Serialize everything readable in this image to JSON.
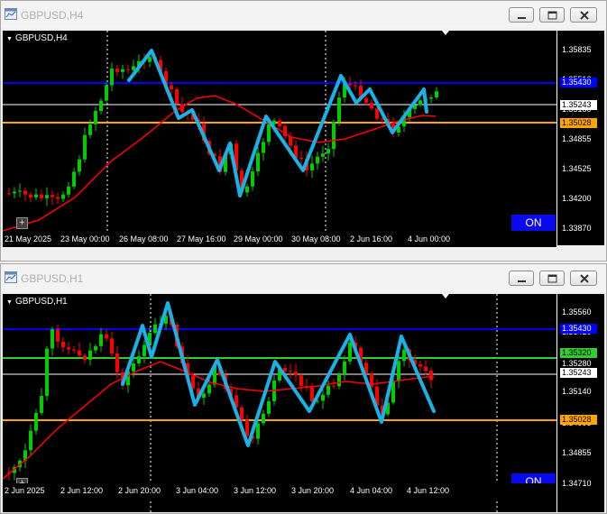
{
  "colors": {
    "bull": "#00cc00",
    "bear": "#ff0000",
    "ma": "#ff0000",
    "zigzag": "#1ab2e6",
    "blue_line": "#0000ff",
    "orange_line": "#ffa500",
    "green_line": "#32cd32",
    "white_line": "#ffffff",
    "on_button": "#0000ff"
  },
  "h4": {
    "title": "GBPUSD,H4",
    "symbol_label": "GBPUSD,H4",
    "on_label": "ON",
    "price_labels": [
      "1.35835",
      "1.35510",
      "1.35180",
      "1.34855",
      "1.34525",
      "1.34200",
      "1.33870"
    ],
    "price_range": [
      1.3387,
      1.3593
    ],
    "time_labels": [
      "21 May 2025",
      "23 May 00:00",
      "26 May 08:00",
      "27 May 16:00",
      "29 May 00:00",
      "30 May 08:00",
      "2 Jun 16:00",
      "4 Jun 00:00"
    ],
    "tags": {
      "blue": "1.35430",
      "white": "1.35243",
      "orange": "1.35028"
    },
    "lines": {
      "blue": 1.3543,
      "white": 1.3524,
      "orange": 1.35028
    }
  },
  "h1": {
    "title": "GBPUSD,H1",
    "symbol_label": "GBPUSD,H1",
    "on_label": "ON",
    "price_labels": [
      "1.35560",
      "1.35420",
      "1.35280",
      "1.35140",
      "1.34995",
      "1.34855",
      "1.34710"
    ],
    "price_range": [
      1.3471,
      1.3562
    ],
    "time_labels": [
      "2 Jun 2025",
      "2 Jun 12:00",
      "2 Jun 20:00",
      "3 Jun 04:00",
      "3 Jun 12:00",
      "3 Jun 20:00",
      "4 Jun 04:00",
      "4 Jun 12:00"
    ],
    "tags": {
      "blue": "1.35430",
      "green": "1.35320",
      "white": "1.35243",
      "orange": "1.35028"
    },
    "lines": {
      "blue": 1.3543,
      "green": 1.3532,
      "white": 1.35243,
      "orange": 1.35028
    }
  }
}
